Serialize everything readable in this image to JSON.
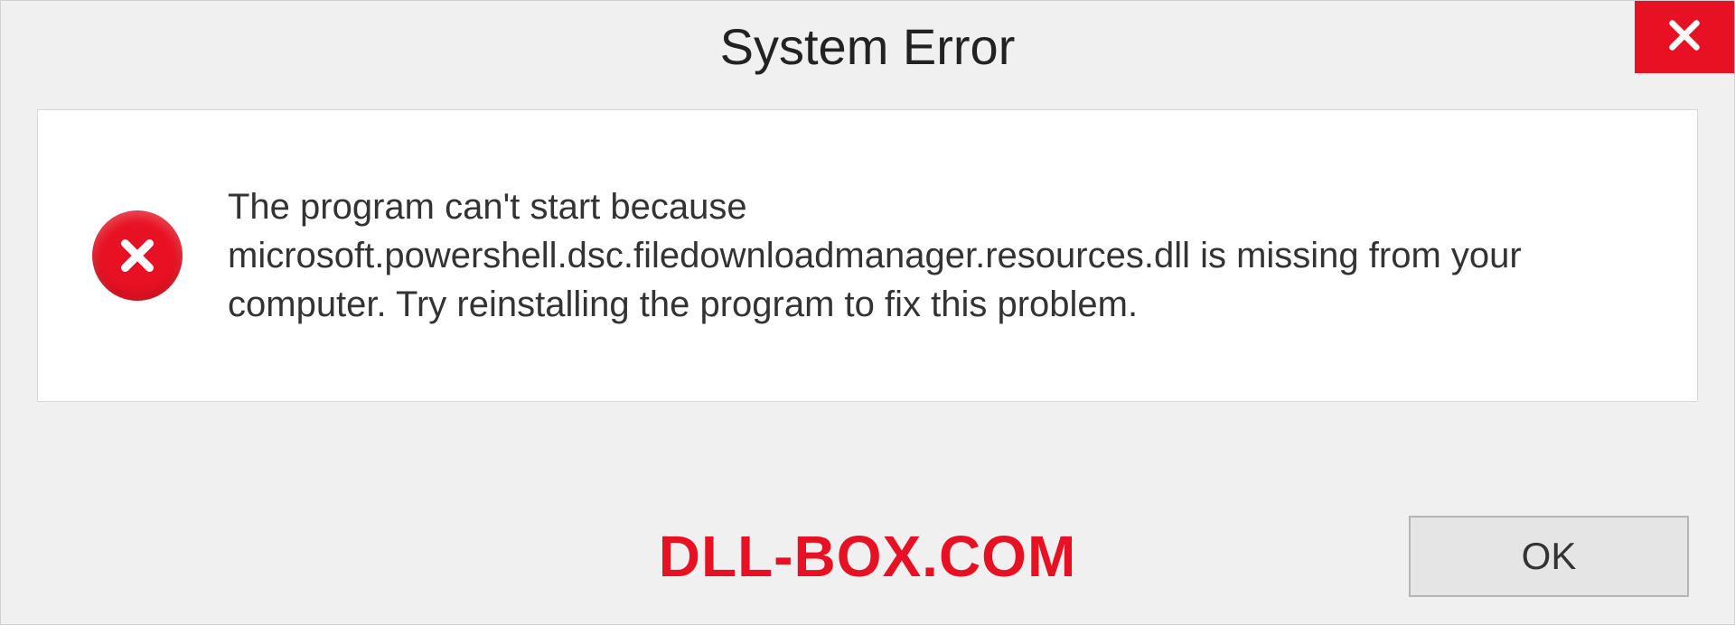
{
  "dialog": {
    "title": "System Error",
    "message": "The program can't start because microsoft.powershell.dsc.filedownloadmanager.resources.dll is missing from your computer. Try reinstalling the program to fix this problem.",
    "ok_label": "OK"
  },
  "watermark": "DLL-BOX.COM",
  "colors": {
    "error_red": "#e81123",
    "panel_bg": "#ffffff",
    "window_bg": "#f0f0f0"
  }
}
